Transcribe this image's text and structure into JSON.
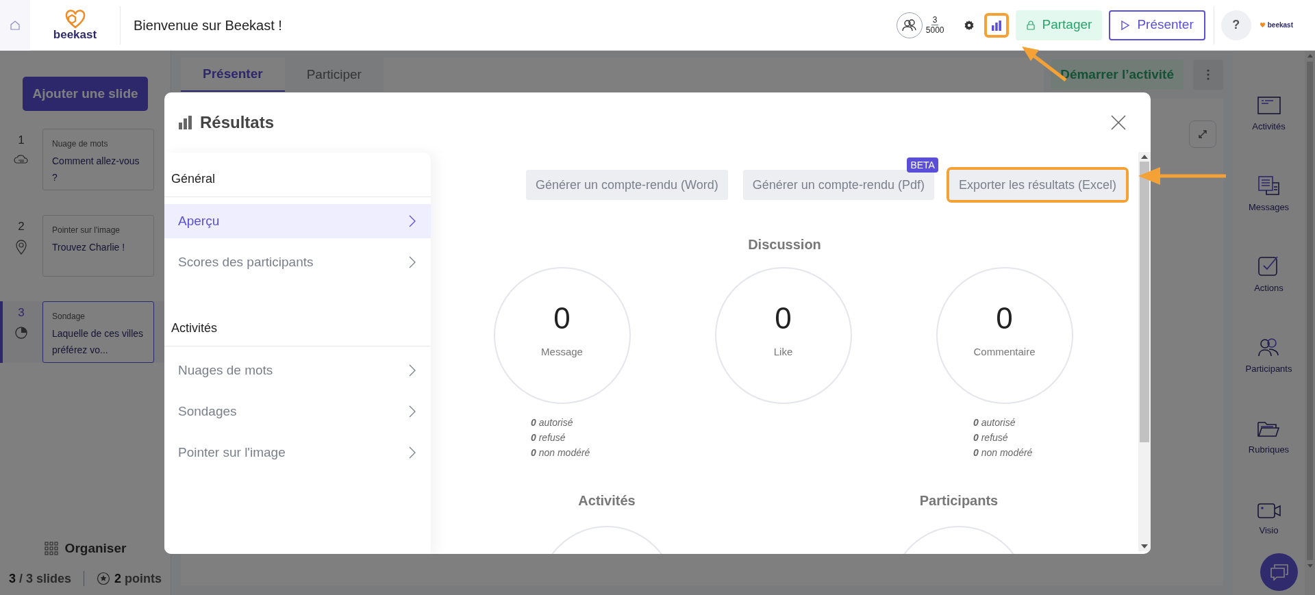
{
  "header": {
    "title": "Bienvenue sur Beekast !",
    "logo_text": "beekast",
    "participants": {
      "count": "3",
      "max": "5000"
    },
    "results_button": {
      "highlighted": true
    },
    "share_button": "Partager",
    "present_button": "Présenter",
    "help_button": "?",
    "brand_text": "beekast"
  },
  "sidebar": {
    "add_button": "Ajouter une slide",
    "slides": [
      {
        "number": "1",
        "type": "Nuage de mots",
        "title": "Comment allez-vous ?",
        "selected": false
      },
      {
        "number": "2",
        "type": "Pointer sur l'image",
        "title": "Trouvez Charlie !",
        "selected": false
      },
      {
        "number": "3",
        "type": "Sondage",
        "title": "Laquelle de ces villes préférez vo...",
        "selected": true
      }
    ],
    "organise": "Organiser",
    "slides_current": "3",
    "slides_label": "/ 3 slides",
    "points_value": "2",
    "points_label": "points"
  },
  "stage": {
    "tabs": [
      {
        "label": "Présenter",
        "selected": true
      },
      {
        "label": "Participer",
        "selected": false
      }
    ],
    "start_button": "Démarrer l’activité"
  },
  "right_sidebar": {
    "items": [
      {
        "label": "Activités"
      },
      {
        "label": "Messages"
      },
      {
        "label": "Actions"
      },
      {
        "label": "Participants"
      },
      {
        "label": "Rubriques"
      },
      {
        "label": "Visio"
      }
    ]
  },
  "modal": {
    "title": "Résultats",
    "nav": [
      {
        "heading": "Général",
        "items": [
          {
            "label": "Aperçu",
            "selected": true
          },
          {
            "label": "Scores des participants",
            "selected": false
          }
        ]
      },
      {
        "heading": "Activités",
        "items": [
          {
            "label": "Nuages de mots",
            "selected": false
          },
          {
            "label": "Sondages",
            "selected": false
          },
          {
            "label": "Pointer sur l'image",
            "selected": false
          }
        ]
      }
    ],
    "export_buttons": [
      {
        "label": "Générer un compte-rendu (Word)",
        "highlighted": false
      },
      {
        "label": "Générer un compte-rendu (Pdf)",
        "badge": "BETA",
        "highlighted": false
      },
      {
        "label": "Exporter les résultats (Excel)",
        "highlighted": true
      }
    ],
    "discussion": {
      "heading": "Discussion",
      "stats": [
        {
          "value": "0",
          "label": "Message",
          "details": [
            "**0** autorisé",
            "**0** refusé",
            "**0** non modéré"
          ]
        },
        {
          "value": "0",
          "label": "Like"
        },
        {
          "value": "0",
          "label": "Commentaire",
          "details": [
            "**0** autorisé",
            "**0** refusé",
            "**0** non modéré"
          ]
        }
      ]
    },
    "sections": [
      {
        "heading": "Activités"
      },
      {
        "heading": "Participants"
      }
    ]
  }
}
